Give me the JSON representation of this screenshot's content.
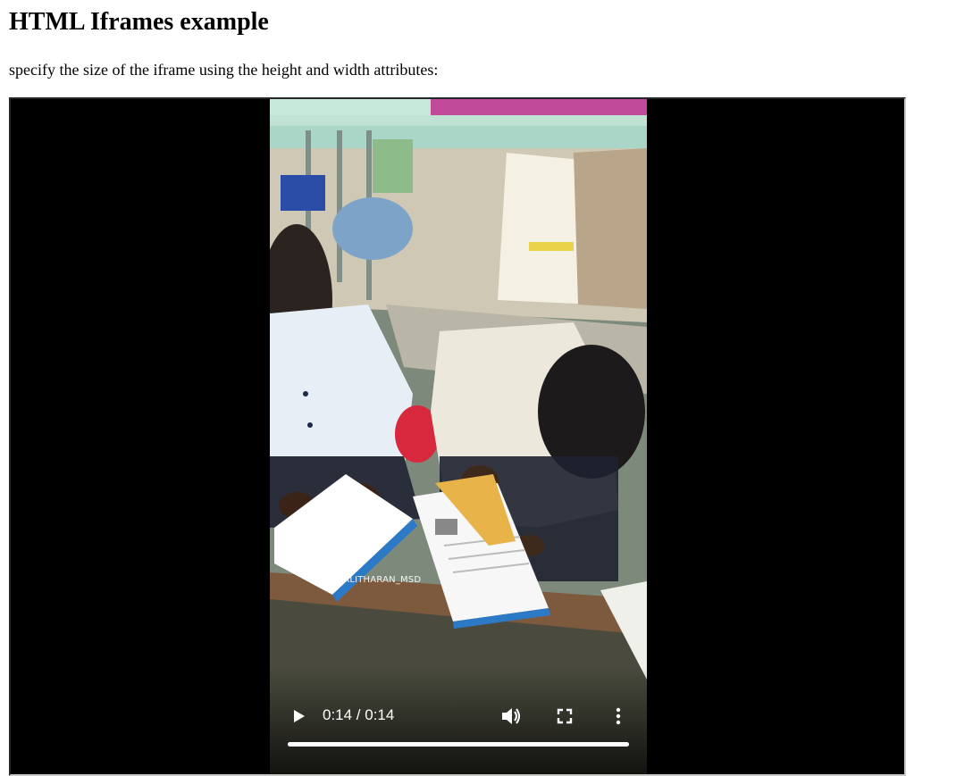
{
  "page": {
    "heading": "HTML Iframes example",
    "description": "specify the size of the iframe using the height and width attributes:"
  },
  "video": {
    "watermark_icon": "instagram-icon",
    "watermark": "@MURALITHARAN_MSD",
    "time_display": "0:14 / 0:14",
    "progress_fraction": 1.0,
    "controls": {
      "play": "play-icon",
      "volume": "volume-icon",
      "fullscreen": "fullscreen-icon",
      "more": "more-vertical-icon"
    }
  }
}
